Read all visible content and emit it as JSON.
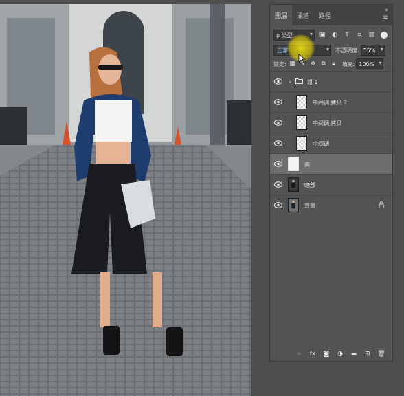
{
  "panel": {
    "tabs": [
      {
        "label": "图层",
        "active": true
      },
      {
        "label": "通道",
        "active": false
      },
      {
        "label": "路径",
        "active": false
      }
    ],
    "close_glyph": "«",
    "filter": {
      "label": "ρ 类型"
    },
    "blend": {
      "mode": "正常",
      "opacity_label": "不透明度:",
      "opacity_value": "55%",
      "fill_label": "填充:",
      "fill_value": "100%"
    },
    "lock_label": "锁定:",
    "layers": [
      {
        "name": "组 1",
        "kind": "group",
        "visible": true
      },
      {
        "name": "中间调 拷贝 2",
        "kind": "transparent",
        "visible": true
      },
      {
        "name": "中间调 拷贝",
        "kind": "transparent",
        "visible": true
      },
      {
        "name": "中间调",
        "kind": "transparent",
        "visible": true
      },
      {
        "name": "高",
        "kind": "white",
        "visible": true,
        "selected": true
      },
      {
        "name": "暗部",
        "kind": "photo",
        "visible": true
      },
      {
        "name": "背景",
        "kind": "photo",
        "visible": true,
        "locked": true
      }
    ],
    "bottom_icons": [
      "link-icon",
      "fx-icon",
      "mask-icon",
      "adjustment-icon",
      "folder-icon",
      "new-layer-icon",
      "trash-icon"
    ],
    "fx_label": "fx"
  },
  "colors": {
    "panel_bg": "#535353",
    "selected_row": "#6e6e6e",
    "accent_text": "#9bd0ff",
    "cursor_highlight": "#f5e60a"
  }
}
